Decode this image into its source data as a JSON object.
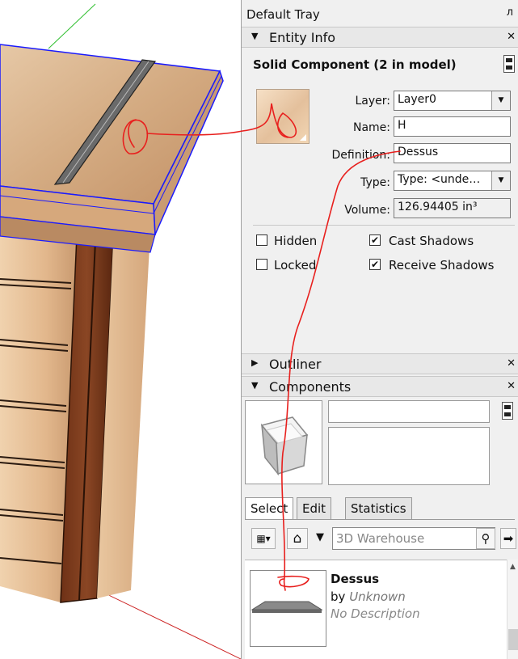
{
  "tray": {
    "title": "Default Tray",
    "pin_glyph": "⮋"
  },
  "entity_info": {
    "header": "Entity Info",
    "title": "Solid Component (2 in model)",
    "fields": {
      "layer": {
        "label": "Layer:",
        "value": "Layer0"
      },
      "name": {
        "label": "Name:",
        "value": "H"
      },
      "definition": {
        "label": "Definition:",
        "value": "Dessus"
      },
      "type": {
        "label": "Type:",
        "value": "Type: <unde…"
      },
      "volume": {
        "label": "Volume:",
        "value": "126.94405 in³"
      }
    },
    "checkboxes": {
      "hidden": {
        "label": "Hidden",
        "checked": false
      },
      "locked": {
        "label": "Locked",
        "checked": false
      },
      "cast_shadows": {
        "label": "Cast Shadows",
        "checked": true
      },
      "receive_shadows": {
        "label": "Receive Shadows",
        "checked": true
      }
    }
  },
  "outliner": {
    "header": "Outliner"
  },
  "components": {
    "header": "Components",
    "tabs": [
      "Select",
      "Edit",
      "Statistics"
    ],
    "active_tab": "Select",
    "search_placeholder": "3D Warehouse",
    "result": {
      "name": "Dessus",
      "by": "by",
      "author": "Unknown",
      "description": "No Description"
    }
  },
  "colors": {
    "selection_blue": "#1a1aff",
    "annotation_red": "#e8201e",
    "wood_light": "#d9b08a",
    "wood_dark": "#7a3d1c"
  },
  "icons": {
    "close": "close-icon",
    "collapse": "triangle-down-icon",
    "expand": "triangle-right-icon",
    "home": "home-icon",
    "search": "magnifier-icon",
    "check": "checkmark-icon"
  }
}
